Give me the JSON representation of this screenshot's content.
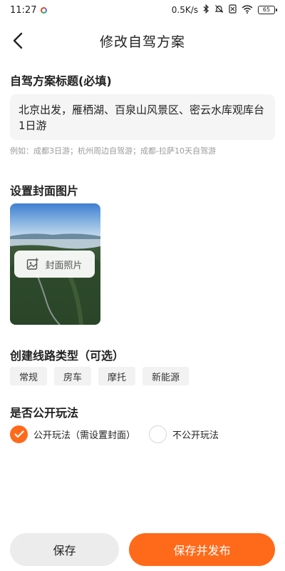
{
  "status_bar": {
    "time": "11:27",
    "network_speed": "0.5K/s",
    "battery": "65",
    "icons": [
      "bluetooth-icon",
      "mute-icon",
      "wifi-icon",
      "battery-icon"
    ]
  },
  "header": {
    "title": "修改自驾方案",
    "back_icon": "chevron-left-icon"
  },
  "plan_title": {
    "label": "自驾方案标题(必填)",
    "value": "北京出发，雁栖湖、百泉山风景区、密云水库观库台1日游",
    "example": "例如：成都3日游；杭州周边自驾游；成都-拉萨10天自驾游"
  },
  "cover": {
    "label": "设置封面图片",
    "button_label": "封面照片",
    "icon": "image-add-icon"
  },
  "route_type": {
    "label": "创建线路类型（可选）",
    "options": [
      "常规",
      "房车",
      "摩托",
      "新能源"
    ]
  },
  "public": {
    "label": "是否公开玩法",
    "options": [
      {
        "label": "公开玩法（需设置封面）",
        "selected": true
      },
      {
        "label": "不公开玩法",
        "selected": false
      }
    ]
  },
  "actions": {
    "save": "保存",
    "publish": "保存并发布"
  },
  "colors": {
    "accent": "#ff6a1a",
    "input_bg": "#f5f5f5",
    "hint": "#9a9a9a"
  }
}
